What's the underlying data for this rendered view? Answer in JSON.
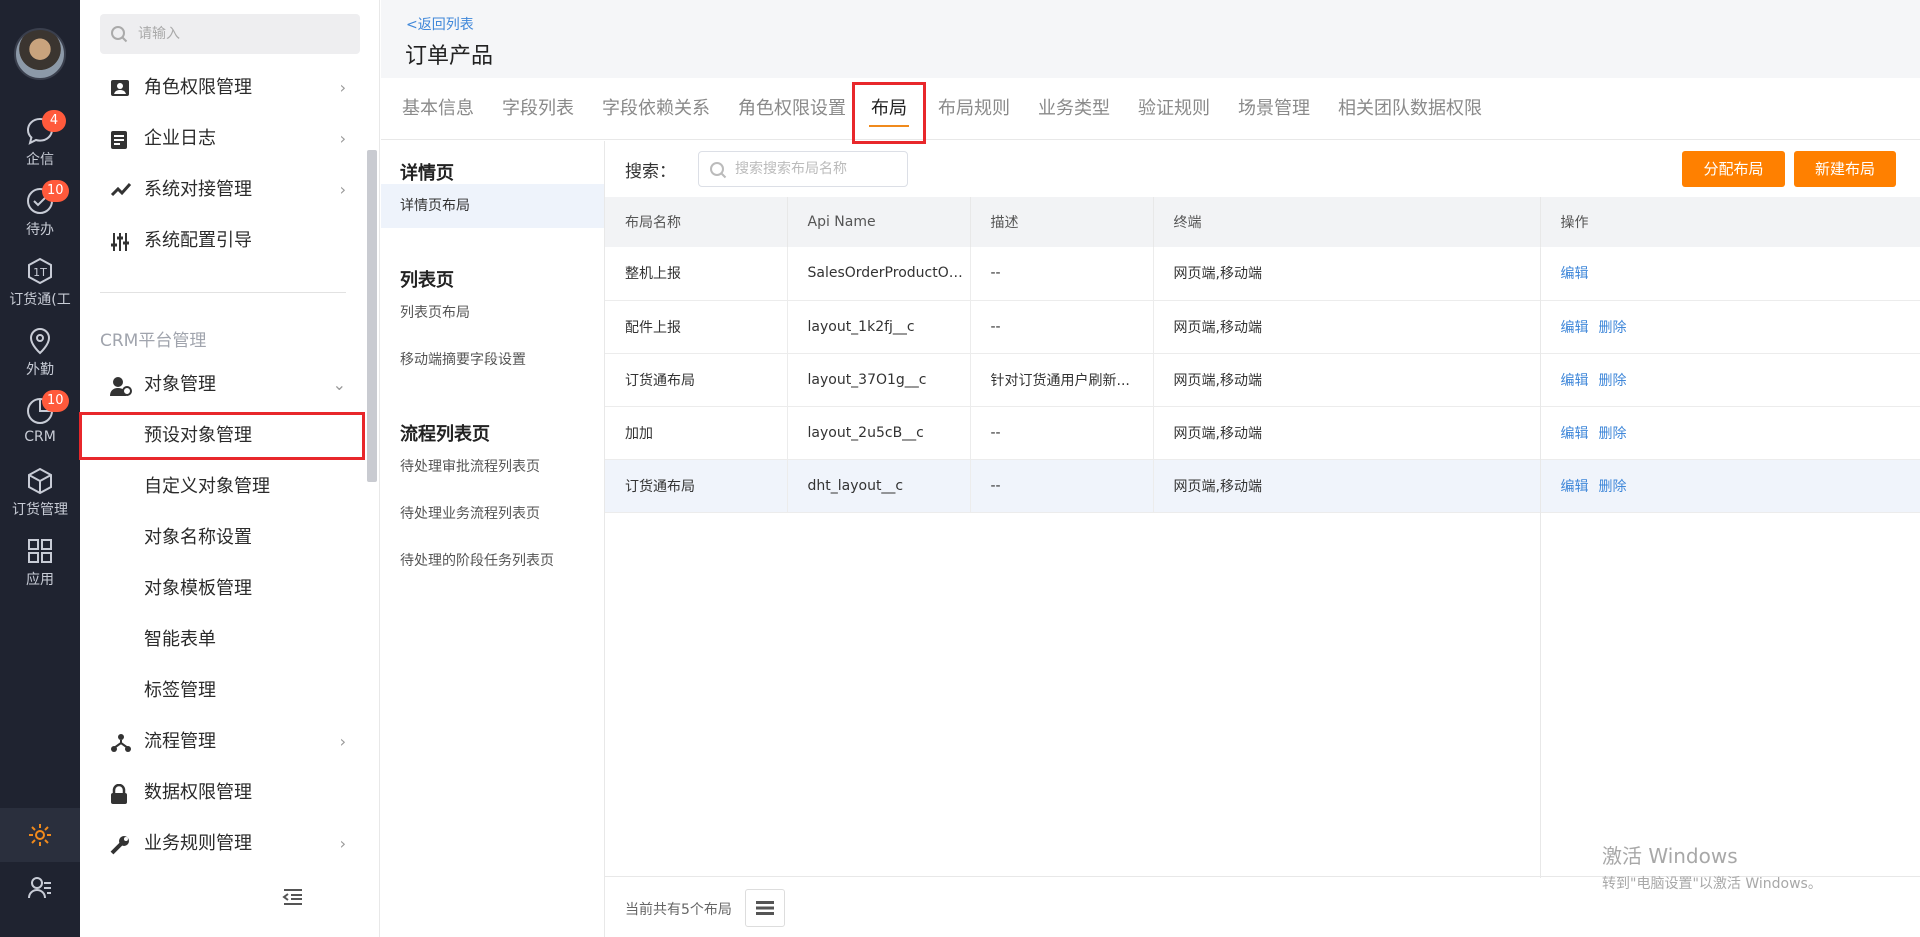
{
  "rail": {
    "items": [
      {
        "label": "企信",
        "badge": "4"
      },
      {
        "label": "待办",
        "badge": "10"
      },
      {
        "label": "订货通(工",
        "badge": ""
      },
      {
        "label": "外勤",
        "badge": ""
      },
      {
        "label": "CRM",
        "badge": "10"
      },
      {
        "label": "订货管理",
        "badge": ""
      },
      {
        "label": "应用",
        "badge": ""
      }
    ]
  },
  "sidebar": {
    "search_placeholder": "请输入",
    "top_items": [
      {
        "label": "角色权限管理"
      },
      {
        "label": "企业日志"
      },
      {
        "label": "系统对接管理"
      },
      {
        "label": "系统配置引导"
      }
    ],
    "group_title": "CRM平台管理",
    "object_mgmt": "对象管理",
    "sub_items": [
      {
        "label": "预设对象管理"
      },
      {
        "label": "自定义对象管理"
      },
      {
        "label": "对象名称设置"
      },
      {
        "label": "对象模板管理"
      },
      {
        "label": "智能表单"
      },
      {
        "label": "标签管理"
      }
    ],
    "bottom_items": [
      {
        "label": "流程管理"
      },
      {
        "label": "数据权限管理"
      },
      {
        "label": "业务规则管理"
      }
    ]
  },
  "header": {
    "back": "<返回列表",
    "title": "订单产品"
  },
  "tabs": [
    {
      "label": "基本信息"
    },
    {
      "label": "字段列表"
    },
    {
      "label": "字段依赖关系"
    },
    {
      "label": "角色权限设置"
    },
    {
      "label": "布局"
    },
    {
      "label": "布局规则"
    },
    {
      "label": "业务类型"
    },
    {
      "label": "验证规则"
    },
    {
      "label": "场景管理"
    },
    {
      "label": "相关团队数据权限"
    }
  ],
  "left_panel": {
    "detail_head": "详情页",
    "detail_items": [
      "详情页布局"
    ],
    "list_head": "列表页",
    "list_items": [
      "列表页布局",
      "移动端摘要字段设置"
    ],
    "flow_head": "流程列表页",
    "flow_items": [
      "待处理审批流程列表页",
      "待处理业务流程列表页",
      "待处理的阶段任务列表页"
    ]
  },
  "toolbar": {
    "search_label": "搜索：",
    "search_placeholder": "搜索搜索布局名称",
    "assign_btn": "分配布局",
    "new_btn": "新建布局"
  },
  "table": {
    "headers": [
      "布局名称",
      "Api Name",
      "描述",
      "终端",
      "操作"
    ],
    "rows": [
      {
        "name": "整机上报",
        "api": "SalesOrderProductObj...",
        "desc": "--",
        "terminal": "网页端,移动端",
        "edit": "编辑",
        "del": ""
      },
      {
        "name": "配件上报",
        "api": "layout_1k2fj__c",
        "desc": "--",
        "terminal": "网页端,移动端",
        "edit": "编辑",
        "del": "删除"
      },
      {
        "name": "订货通布局",
        "api": "layout_37O1g__c",
        "desc": "针对订货通用户刷新...",
        "terminal": "网页端,移动端",
        "edit": "编辑",
        "del": "删除"
      },
      {
        "name": "加加",
        "api": "layout_2u5cB__c",
        "desc": "--",
        "terminal": "网页端,移动端",
        "edit": "编辑",
        "del": "删除"
      },
      {
        "name": "订货通布局",
        "api": "dht_layout__c",
        "desc": "--",
        "terminal": "网页端,移动端",
        "edit": "编辑",
        "del": "删除"
      }
    ]
  },
  "footer": {
    "count": "当前共有5个布局"
  },
  "watermark": {
    "line1": "激活 Windows",
    "line2": "转到\"电脑设置\"以激活 Windows。"
  }
}
